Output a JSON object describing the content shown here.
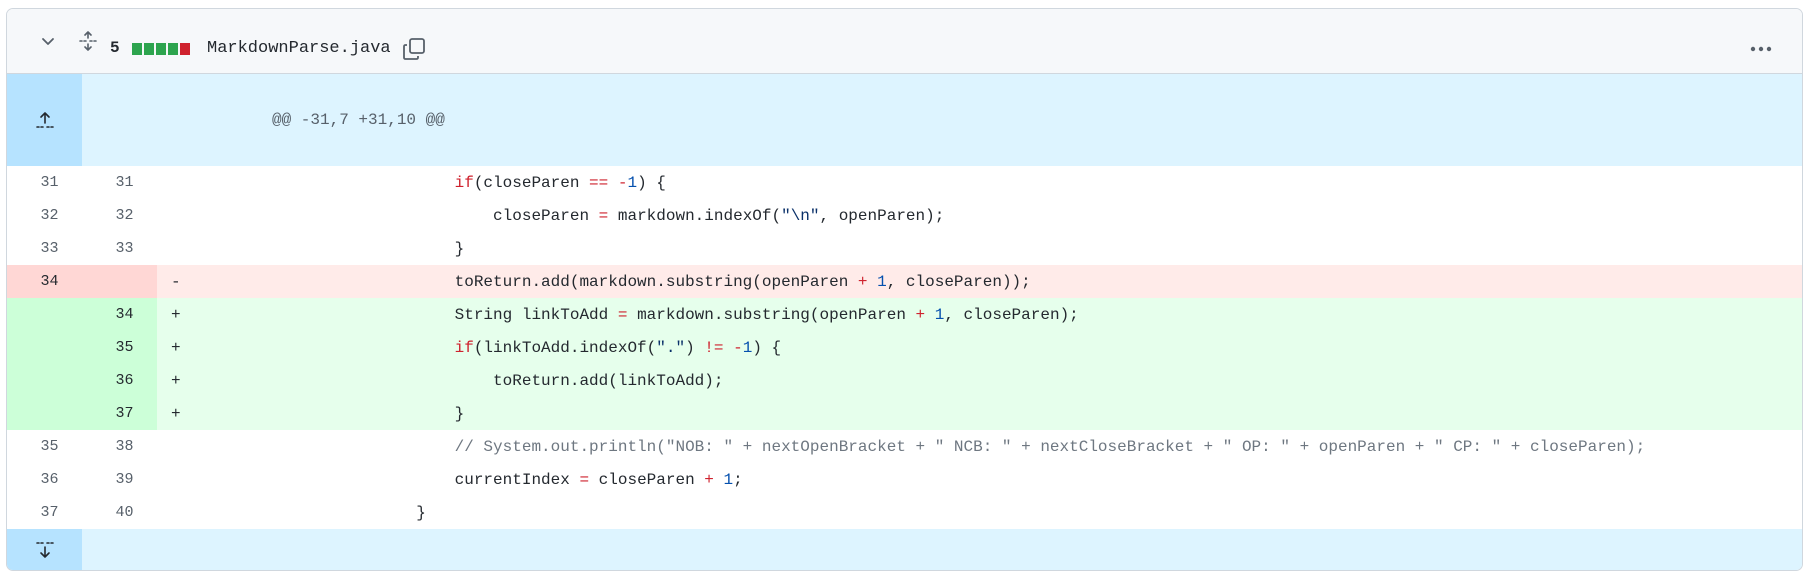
{
  "header": {
    "changes_count": "5",
    "diffstat": [
      "#2da44e",
      "#2da44e",
      "#2da44e",
      "#2da44e",
      "#cf222e"
    ],
    "filename": "MarkdownParse.java",
    "icons": {
      "collapse": "chevron-down-icon",
      "expand_all": "unfold-icon",
      "copy": "copy-icon",
      "more": "kebab-horizontal-icon"
    }
  },
  "hunk": {
    "header": "@@ -31,7 +31,10 @@",
    "expand_up_icon": "expand-up-icon",
    "expand_down_icon": "expand-down-icon"
  },
  "lines": [
    {
      "type": "ctx",
      "old": "31",
      "new": "31",
      "marker": "",
      "indent": "                ",
      "tokens": [
        [
          "kw",
          "if"
        ],
        [
          "",
          "(closeParen "
        ],
        [
          "kw",
          "=="
        ],
        [
          "",
          " "
        ],
        [
          "kw",
          "-"
        ],
        [
          "num-lit",
          "1"
        ],
        [
          "",
          ") {"
        ]
      ]
    },
    {
      "type": "ctx",
      "old": "32",
      "new": "32",
      "marker": "",
      "indent": "                    ",
      "tokens": [
        [
          "",
          "closeParen "
        ],
        [
          "kw",
          "="
        ],
        [
          "",
          " markdown.indexOf("
        ],
        [
          "str",
          "\"\\n\""
        ],
        [
          "",
          ", openParen);"
        ]
      ]
    },
    {
      "type": "ctx",
      "old": "33",
      "new": "33",
      "marker": "",
      "indent": "                ",
      "tokens": [
        [
          "",
          "}"
        ]
      ]
    },
    {
      "type": "del",
      "old": "34",
      "new": "",
      "marker": "-",
      "indent": "                ",
      "tokens": [
        [
          "",
          "toReturn.add(markdown.substring(openParen "
        ],
        [
          "kw",
          "+"
        ],
        [
          "",
          " "
        ],
        [
          "num-lit",
          "1"
        ],
        [
          "",
          ", closeParen));"
        ]
      ]
    },
    {
      "type": "add",
      "old": "",
      "new": "34",
      "marker": "+",
      "indent": "                ",
      "tokens": [
        [
          "",
          "String linkToAdd "
        ],
        [
          "kw",
          "="
        ],
        [
          "",
          " markdown.substring(openParen "
        ],
        [
          "kw",
          "+"
        ],
        [
          "",
          " "
        ],
        [
          "num-lit",
          "1"
        ],
        [
          "",
          ", closeParen);"
        ]
      ]
    },
    {
      "type": "add",
      "old": "",
      "new": "35",
      "marker": "+",
      "indent": "                ",
      "tokens": [
        [
          "kw",
          "if"
        ],
        [
          "",
          "(linkToAdd.indexOf("
        ],
        [
          "str",
          "\".\""
        ],
        [
          "",
          ") "
        ],
        [
          "kw",
          "!="
        ],
        [
          "",
          " "
        ],
        [
          "kw",
          "-"
        ],
        [
          "num-lit",
          "1"
        ],
        [
          "",
          ") {"
        ]
      ]
    },
    {
      "type": "add",
      "old": "",
      "new": "36",
      "marker": "+",
      "indent": "                    ",
      "tokens": [
        [
          "",
          "toReturn.add(linkToAdd);"
        ]
      ]
    },
    {
      "type": "add",
      "old": "",
      "new": "37",
      "marker": "+",
      "indent": "                ",
      "tokens": [
        [
          "",
          "}"
        ]
      ]
    },
    {
      "type": "ctx",
      "old": "35",
      "new": "38",
      "marker": "",
      "indent": "                ",
      "tokens": [
        [
          "cmt",
          "// System.out.println(\"NOB: \" + nextOpenBracket + \" NCB: \" + nextCloseBracket + \" OP: \" + openParen + \" CP: \" + closeParen);"
        ]
      ]
    },
    {
      "type": "ctx",
      "old": "36",
      "new": "39",
      "marker": "",
      "indent": "                ",
      "tokens": [
        [
          "",
          "currentIndex "
        ],
        [
          "kw",
          "="
        ],
        [
          "",
          " closeParen "
        ],
        [
          "kw",
          "+"
        ],
        [
          "",
          " "
        ],
        [
          "num-lit",
          "1"
        ],
        [
          "",
          ";"
        ]
      ]
    },
    {
      "type": "ctx",
      "old": "37",
      "new": "40",
      "marker": "",
      "indent": "            ",
      "tokens": [
        [
          "",
          "}"
        ]
      ]
    }
  ]
}
